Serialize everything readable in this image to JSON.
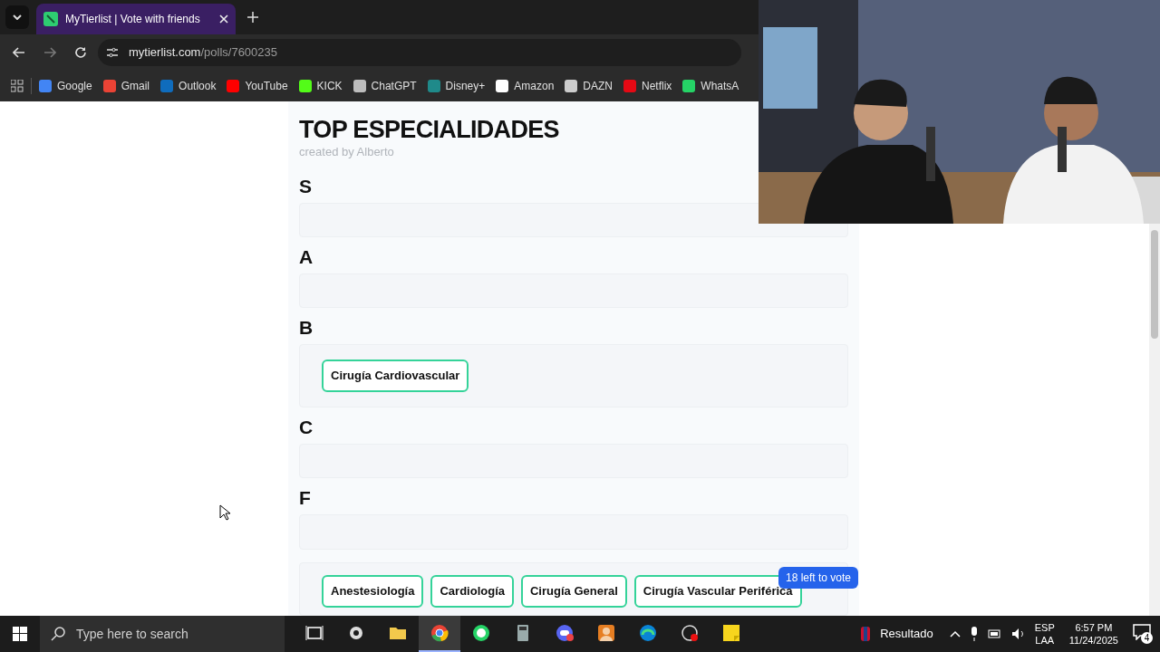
{
  "browser": {
    "tab_title": "MyTierlist | Vote with friends",
    "address_domain": "mytierlist.com",
    "address_path": "/polls/7600235",
    "bookmarks": [
      {
        "label": "Google",
        "color": "#4285f4"
      },
      {
        "label": "Gmail",
        "color": "#ea4335"
      },
      {
        "label": "Outlook",
        "color": "#0f6cbd"
      },
      {
        "label": "YouTube",
        "color": "#ff0000"
      },
      {
        "label": "KICK",
        "color": "#53fc18"
      },
      {
        "label": "ChatGPT",
        "color": "#bdbdbd"
      },
      {
        "label": "Disney+",
        "color": "#1f8a8a"
      },
      {
        "label": "Amazon",
        "color": "#ffffff"
      },
      {
        "label": "DAZN",
        "color": "#cccccc"
      },
      {
        "label": "Netflix",
        "color": "#e50914"
      },
      {
        "label": "WhatsA",
        "color": "#25d366"
      }
    ]
  },
  "page": {
    "title": "TOP ESPECIALIDADES",
    "created_by": "created by Alberto",
    "tiers": [
      {
        "label": "S"
      },
      {
        "label": "A"
      },
      {
        "label": "B",
        "items": [
          "Cirugía Cardiovascular"
        ]
      },
      {
        "label": "C"
      },
      {
        "label": "F"
      }
    ],
    "pool": [
      "Anestesiología",
      "Cardiología",
      "Cirugía General",
      "Cirugía Vascular Periférica"
    ],
    "votes_left": "18 left to vote"
  },
  "taskbar": {
    "search_placeholder": "Type here to search",
    "apps": [
      {
        "kind": "taskview",
        "selected": false
      },
      {
        "kind": "settings",
        "selected": false
      },
      {
        "kind": "folder",
        "selected": false
      },
      {
        "kind": "chrome",
        "selected": true
      },
      {
        "kind": "whatsapp",
        "selected": false
      },
      {
        "kind": "calculator",
        "selected": false
      },
      {
        "kind": "discord",
        "selected": false
      },
      {
        "kind": "avatar",
        "selected": false
      },
      {
        "kind": "edge",
        "selected": false
      },
      {
        "kind": "recorder",
        "selected": false
      },
      {
        "kind": "notes",
        "selected": false
      }
    ],
    "weather": "Resultado",
    "lang_top": "ESP",
    "lang_bottom": "LAA",
    "time": "6:57 PM",
    "date": "11/24/2025",
    "notifications": "4"
  }
}
